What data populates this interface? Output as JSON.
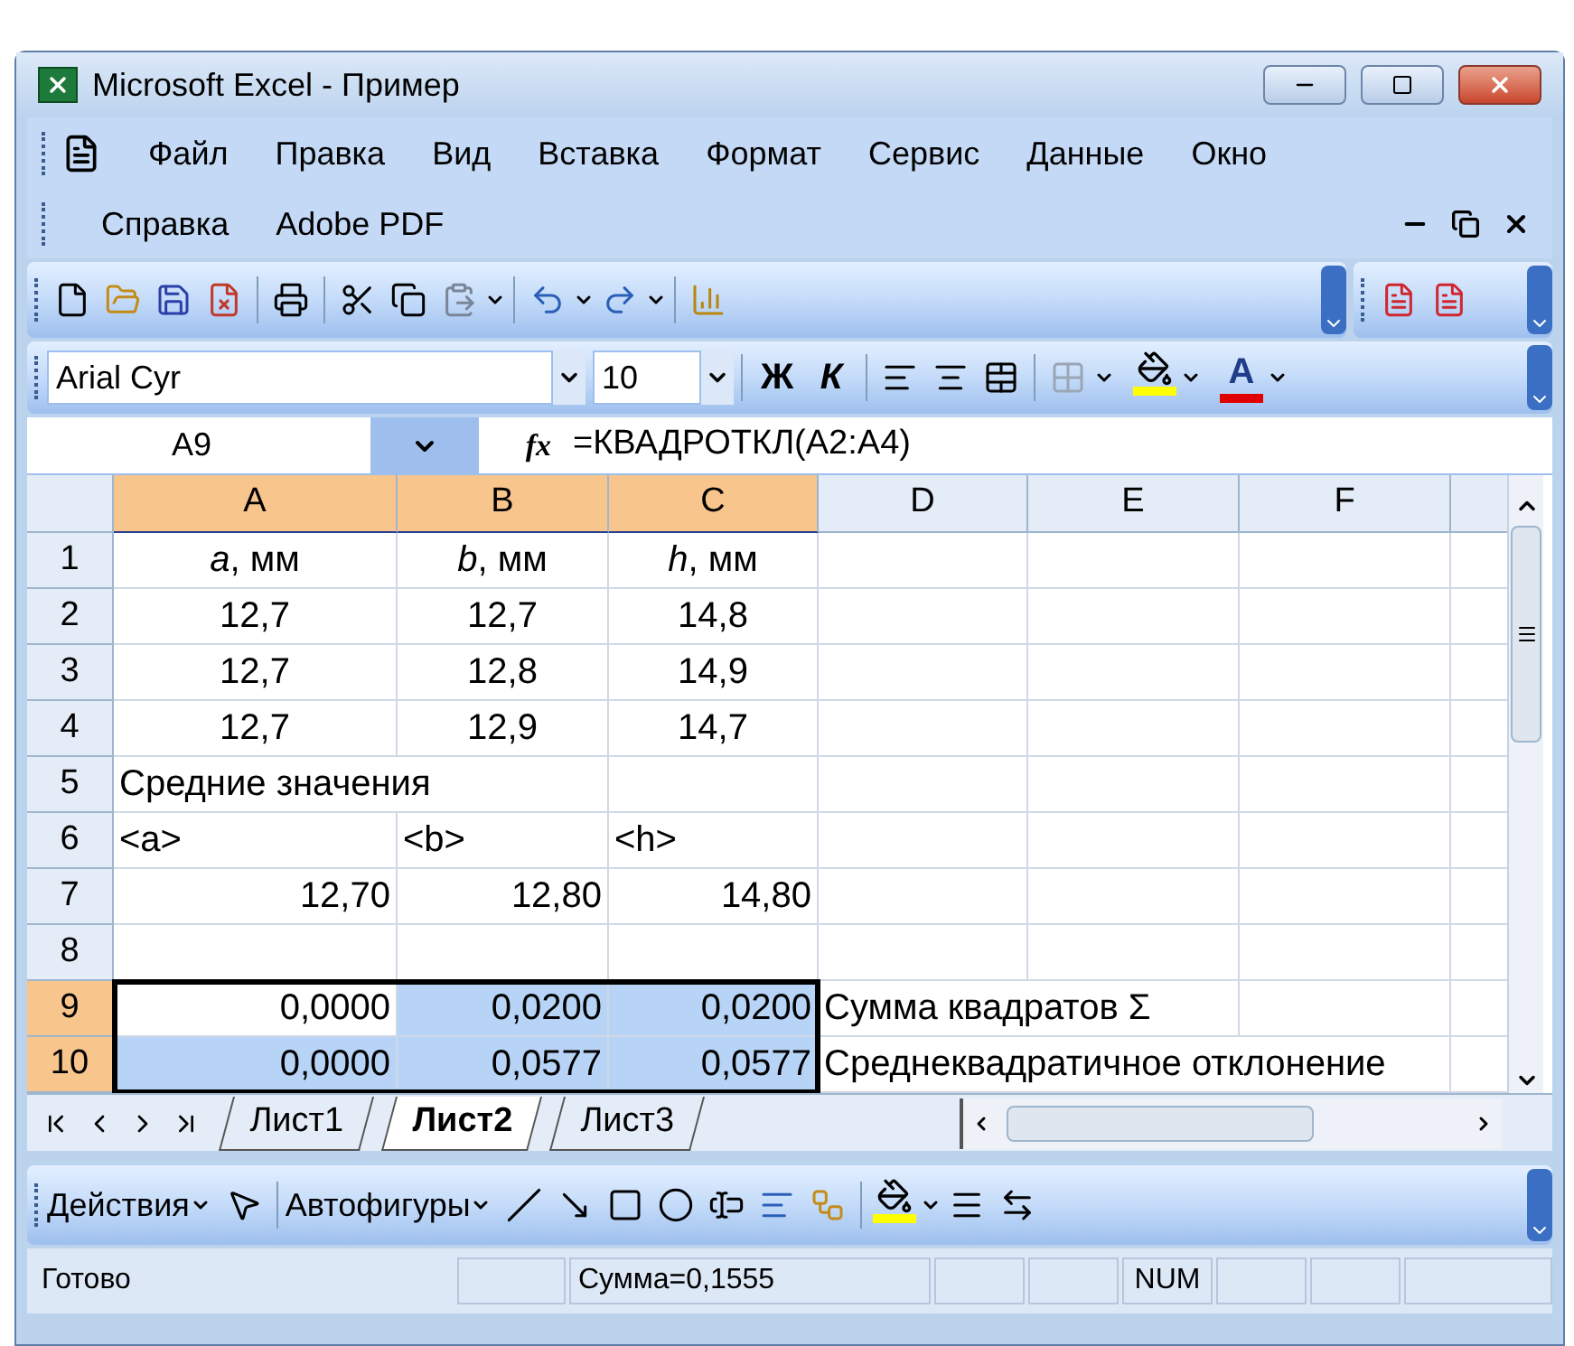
{
  "window": {
    "title": "Microsoft Excel - Пример"
  },
  "menu": [
    "Файл",
    "Правка",
    "Вид",
    "Вставка",
    "Формат",
    "Сервис",
    "Данные",
    "Окно",
    "Справка",
    "Adobe PDF"
  ],
  "format_toolbar": {
    "font": "Arial Cyr",
    "size": "10",
    "bold": "Ж",
    "italic": "К",
    "font_color": "A"
  },
  "formula_bar": {
    "name_box": "A9",
    "fx": "fx",
    "formula": "=КВАДРОТКЛ(A2:A4)"
  },
  "columns": [
    {
      "label": "A",
      "selected": true
    },
    {
      "label": "B",
      "selected": true
    },
    {
      "label": "C",
      "selected": true
    },
    {
      "label": "D",
      "selected": false
    },
    {
      "label": "E",
      "selected": false
    },
    {
      "label": "F",
      "selected": false
    }
  ],
  "rows": [
    {
      "header": "1",
      "selected": false,
      "kind": "heading",
      "cells": [
        {
          "text": "*a*, мм",
          "selected": false
        },
        {
          "text": "*b*, мм",
          "selected": false
        },
        {
          "text": "*h*, мм",
          "selected": false
        },
        {
          "selected": false
        },
        {
          "selected": false
        },
        {
          "selected": false
        }
      ]
    },
    {
      "header": "2",
      "selected": false,
      "kind": "heading",
      "cells": [
        {
          "text": "12,7",
          "selected": false
        },
        {
          "text": "12,7",
          "selected": false
        },
        {
          "text": "14,8",
          "selected": false
        },
        {
          "selected": false
        },
        {
          "selected": false
        },
        {
          "selected": false
        }
      ]
    },
    {
      "header": "3",
      "selected": false,
      "kind": "heading",
      "cells": [
        {
          "text": "12,7",
          "selected": false
        },
        {
          "text": "12,8",
          "selected": false
        },
        {
          "text": "14,9",
          "selected": false
        },
        {
          "selected": false
        },
        {
          "selected": false
        },
        {
          "selected": false
        }
      ]
    },
    {
      "header": "4",
      "selected": false,
      "kind": "heading",
      "cells": [
        {
          "text": "12,7",
          "selected": false
        },
        {
          "text": "12,9",
          "selected": false
        },
        {
          "text": "14,7",
          "selected": false
        },
        {
          "selected": false
        },
        {
          "selected": false
        },
        {
          "selected": false
        }
      ]
    },
    {
      "header": "5",
      "selected": false,
      "kind": "text",
      "cells": [
        {
          "text": "Средние значения",
          "selected": false
        },
        {
          "selected": false
        },
        {
          "selected": false
        },
        {
          "selected": false
        },
        {
          "selected": false
        },
        {
          "selected": false
        }
      ]
    },
    {
      "header": "6",
      "selected": false,
      "kind": "text",
      "cells": [
        {
          "text": "<a>",
          "selected": false
        },
        {
          "text": "<b>",
          "selected": false
        },
        {
          "text": "<h>",
          "selected": false
        },
        {
          "selected": false
        },
        {
          "selected": false
        },
        {
          "selected": false
        }
      ]
    },
    {
      "header": "7",
      "selected": false,
      "kind": "number",
      "cells": [
        {
          "text": "12,70",
          "selected": false
        },
        {
          "text": "12,80",
          "selected": false
        },
        {
          "text": "14,80",
          "selected": false
        },
        {
          "selected": false
        },
        {
          "selected": false
        },
        {
          "selected": false
        }
      ]
    },
    {
      "header": "8",
      "selected": false,
      "kind": "number",
      "cells": [
        {
          "selected": false
        },
        {
          "selected": false
        },
        {
          "selected": false
        },
        {
          "selected": false
        },
        {
          "selected": false
        },
        {
          "selected": false
        }
      ]
    },
    {
      "header": "9",
      "selected": true,
      "kind": "number",
      "cells": [
        {
          "text": "0,0000",
          "selected": false
        },
        {
          "text": "0,0200",
          "selected": true
        },
        {
          "text": "0,0200",
          "selected": true
        },
        {
          "text": "Сумма квадратов Σ",
          "selected": false
        },
        {
          "selected": false
        },
        {
          "selected": false
        }
      ]
    },
    {
      "header": "10",
      "selected": true,
      "kind": "number",
      "cells": [
        {
          "text": "0,0000",
          "selected": true
        },
        {
          "text": "0,0577",
          "selected": true
        },
        {
          "text": "0,0577",
          "selected": true
        },
        {
          "text": "Среднеквадратичное отклонение",
          "selected": false
        },
        {
          "selected": false
        },
        {
          "selected": false
        }
      ]
    }
  ],
  "sheet_tabs": [
    {
      "label": "Лист1",
      "selected": false
    },
    {
      "label": "Лист2",
      "selected": true
    },
    {
      "label": "Лист3",
      "selected": false
    }
  ],
  "drawing_toolbar": {
    "actions": "Действия",
    "autoshapes": "Автофигуры"
  },
  "status_bar": {
    "status": "Готово",
    "sum": "Сумма=0,1555",
    "num": "NUM"
  }
}
